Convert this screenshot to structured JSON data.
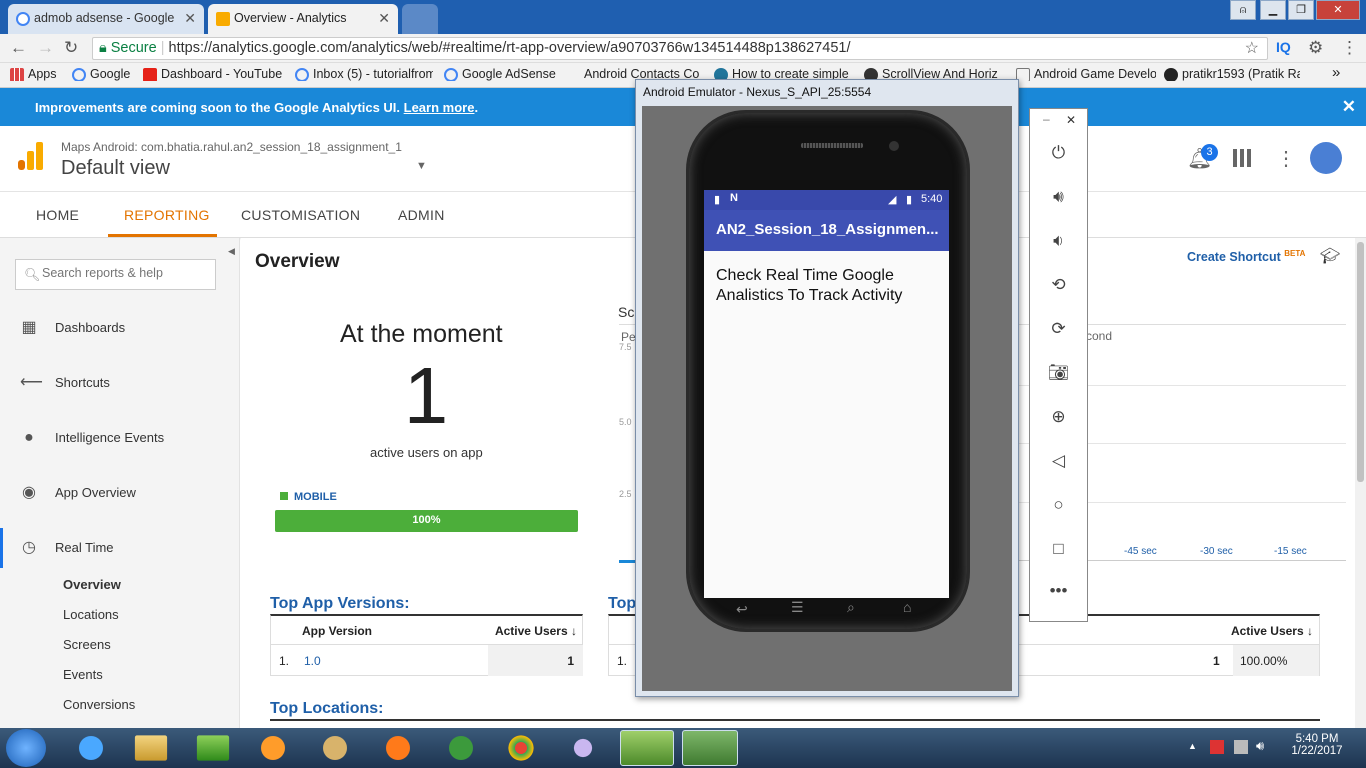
{
  "browser": {
    "tabs": [
      {
        "title": "admob adsense - Google"
      },
      {
        "title": "Overview - Analytics"
      }
    ],
    "secure_label": "Secure",
    "url": "https://analytics.google.com/analytics/web/#realtime/rt-app-overview/a90703766w134514488p138627451/",
    "extension_label": "IQ",
    "bookmarks": [
      "Apps",
      "Google",
      "Dashboard - YouTube",
      "Inbox (5) - tutorialfrom",
      "Google AdSense",
      "Android Contacts Co",
      "How to create simple",
      "ScrollView And Horiz",
      "Android Game Develo",
      "pratikr1593 (Pratik Ra"
    ],
    "more": "»"
  },
  "banner": {
    "text": "Improvements are coming soon to the Google Analytics UI. ",
    "link": "Learn more",
    "end": "."
  },
  "ga": {
    "property": "Maps Android: com.bhatia.rahul.an2_session_18_assignment_1",
    "view": "Default view",
    "notification_count": "3",
    "nav": [
      "HOME",
      "REPORTING",
      "CUSTOMISATION",
      "ADMIN"
    ]
  },
  "sidebar": {
    "search_placeholder": "Search reports & help",
    "items": [
      "Dashboards",
      "Shortcuts",
      "Intelligence Events",
      "App Overview",
      "Real Time"
    ],
    "subitems": [
      "Overview",
      "Locations",
      "Screens",
      "Events",
      "Conversions"
    ]
  },
  "main": {
    "title": "Overview",
    "shortcut": "Create Shortcut",
    "beta": "BETA",
    "moment_title": "At the moment",
    "active_count": "1",
    "active_label": "active users on app",
    "mobile_label": "MOBILE",
    "mobile_pct": "100%",
    "mobile_fraction": 1.0,
    "chart_partial_title": "Sc",
    "chart_partial_label": "Pe",
    "chart_partial_label2": "cond",
    "y_ticks": [
      "7.5",
      "5.0",
      "2.5"
    ],
    "x_ticks": [
      "-45 sec",
      "-30 sec",
      "-15 sec"
    ],
    "top_versions_title": "Top App Versions:",
    "top2_title": "Top",
    "col_version": "App Version",
    "col_active": "Active Users",
    "version_row": {
      "idx": "1.",
      "version": "1.0",
      "users": "1"
    },
    "row2": {
      "idx": "1.",
      "users": "1",
      "pct": "100.00%"
    },
    "top_locations_title": "Top Locations:"
  },
  "emulator": {
    "title": "Android Emulator - Nexus_S_API_25:5554",
    "time": "5:40",
    "app_title": "AN2_Session_18_Assignmen...",
    "content": "Check Real Time Google Analistics To Track Activity"
  },
  "taskbar": {
    "time": "5:40 PM",
    "date": "1/22/2017"
  }
}
